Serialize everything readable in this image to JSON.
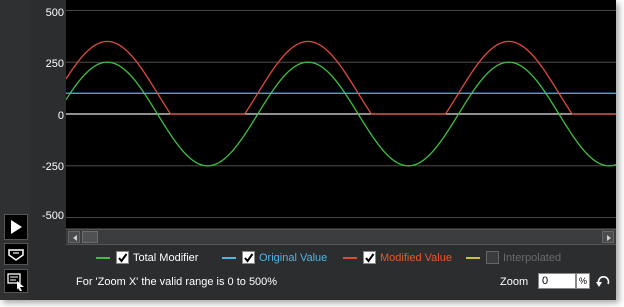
{
  "chart_data": {
    "type": "line",
    "y_ticks": [
      "500",
      "250",
      "0",
      "-250",
      "-500"
    ],
    "ylim": [
      -550,
      550
    ],
    "grid": true,
    "series": [
      {
        "name": "Total Modifier",
        "color": "#3fbf3f",
        "kind": "sinusoid",
        "amplitude": 250,
        "offset": 0,
        "peaks_x_fraction": [
          0.075,
          0.44,
          0.805
        ],
        "period_fraction": 0.365
      },
      {
        "name": "Original Value",
        "color": "#4fb6e6",
        "kind": "constant",
        "value": 100
      },
      {
        "name": "Modified Value",
        "color": "#e04a3a",
        "kind": "sinusoid_clipped",
        "amplitude": 250,
        "offset": 100,
        "clip_min": 0,
        "peaks_x_fraction": [
          0.075,
          0.44,
          0.805
        ],
        "period_fraction": 0.365
      }
    ]
  },
  "legend": [
    {
      "label": "Total Modifier",
      "checked": true,
      "enabled": true,
      "swatch_color": "#3fbf3f",
      "label_color": "#ffffff"
    },
    {
      "label": "Original Value",
      "checked": true,
      "enabled": true,
      "swatch_color": "#4fb6e6",
      "label_color": "#4fb6e6"
    },
    {
      "label": "Modified Value",
      "checked": true,
      "enabled": true,
      "swatch_color": "#e04a3a",
      "label_color": "#e8572e"
    },
    {
      "label": "Interpolated",
      "checked": false,
      "enabled": false,
      "swatch_color": "#c9c23a",
      "label_color": "#6a6a6a"
    }
  ],
  "footer": {
    "range_note": "For 'Zoom X' the valid range is 0 to 500%",
    "zoom_label": "Zoom",
    "zoom_value": "0",
    "zoom_unit": "%"
  },
  "icons": {
    "play": "play-icon",
    "tool_1": "curve-tool-icon",
    "tool_2": "select-tool-icon",
    "reset": "reset-zoom-icon"
  }
}
